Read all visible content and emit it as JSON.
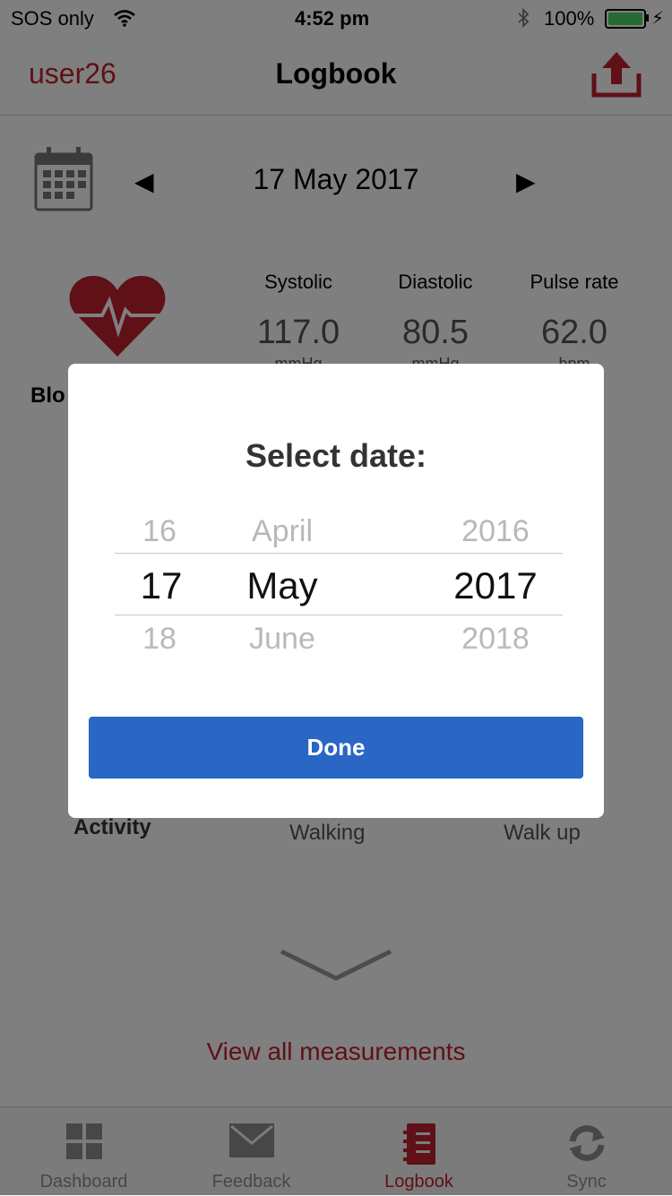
{
  "status_bar": {
    "carrier": "SOS only",
    "time": "4:52 pm",
    "battery": "100%"
  },
  "nav": {
    "user": "user26",
    "title": "Logbook"
  },
  "date_nav": {
    "date": "17 May 2017"
  },
  "blood_pressure": {
    "label": "Blo",
    "columns": [
      {
        "label": "Systolic",
        "value": "117.0",
        "unit": "mmHg"
      },
      {
        "label": "Diastolic",
        "value": "80.5",
        "unit": "mmHg"
      },
      {
        "label": "Pulse rate",
        "value": "62.0",
        "unit": "bpm"
      }
    ]
  },
  "activity": {
    "label": "Activity",
    "items": [
      "Walking",
      "Walk up"
    ]
  },
  "view_all": "View all measurements",
  "tabs": [
    {
      "label": "Dashboard",
      "icon": "grid-icon"
    },
    {
      "label": "Feedback",
      "icon": "envelope-icon"
    },
    {
      "label": "Logbook",
      "icon": "notebook-icon"
    },
    {
      "label": "Sync",
      "icon": "sync-icon"
    }
  ],
  "date_picker": {
    "title": "Select date:",
    "day": {
      "prev": "16",
      "selected": "17",
      "next": "18"
    },
    "month": {
      "prev": "April",
      "selected": "May",
      "next": "June"
    },
    "year": {
      "prev": "2016",
      "selected": "2017",
      "next": "2018"
    },
    "done_label": "Done"
  },
  "colors": {
    "accent": "#c0202e",
    "primary_button": "#2a66c4",
    "battery": "#4cd964"
  }
}
